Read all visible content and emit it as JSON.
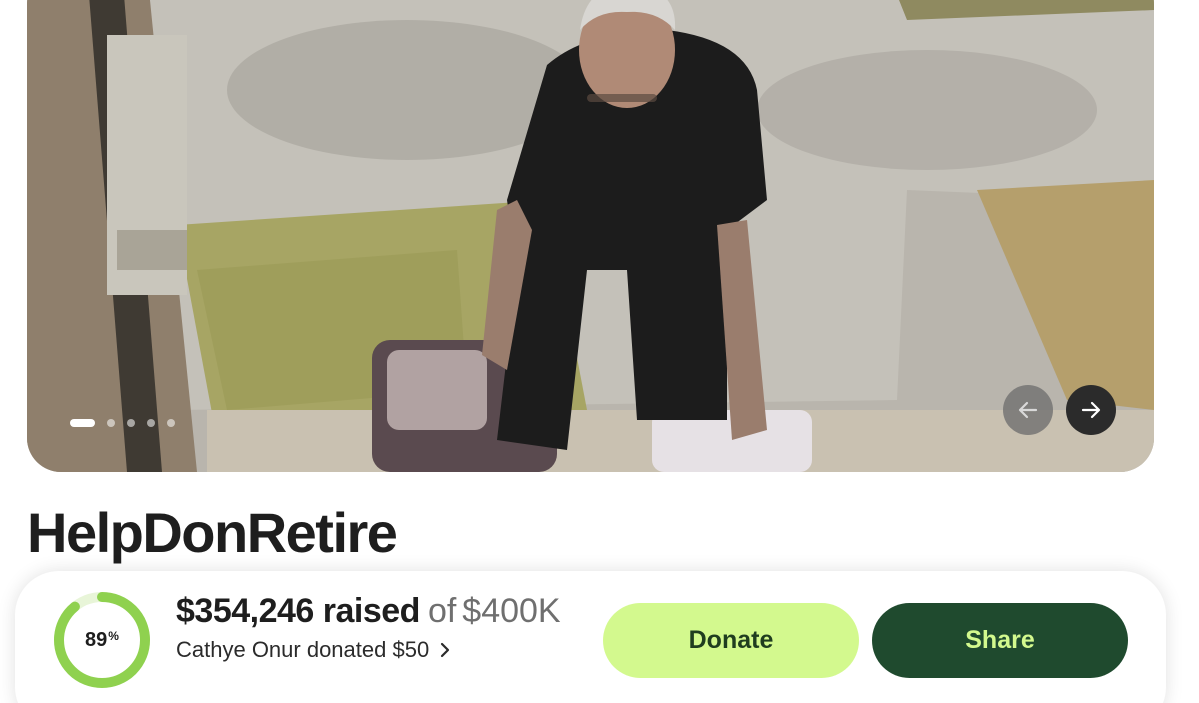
{
  "campaign": {
    "title": "HelpDonRetire"
  },
  "carousel": {
    "image_description": "photo",
    "slide_count": 5,
    "active_index": 0,
    "prev_icon": "arrow-left-icon",
    "next_icon": "arrow-right-icon"
  },
  "fundraiser": {
    "raised_label": "$354,246 raised",
    "of_label": "of",
    "goal_label": "$400K",
    "progress_percent_value": 89,
    "progress_percent": "89",
    "percent_symbol": "%",
    "recent_donation": "Cathye Onur donated $50",
    "recent_donation_icon": "chevron-right-icon"
  },
  "actions": {
    "donate_label": "Donate",
    "share_label": "Share"
  },
  "colors": {
    "progress_green": "#8fd14f",
    "progress_track": "#e8f5d8",
    "donate_bg": "#d3f98e",
    "share_bg": "#1f4a2e",
    "share_text": "#d3f98e"
  }
}
